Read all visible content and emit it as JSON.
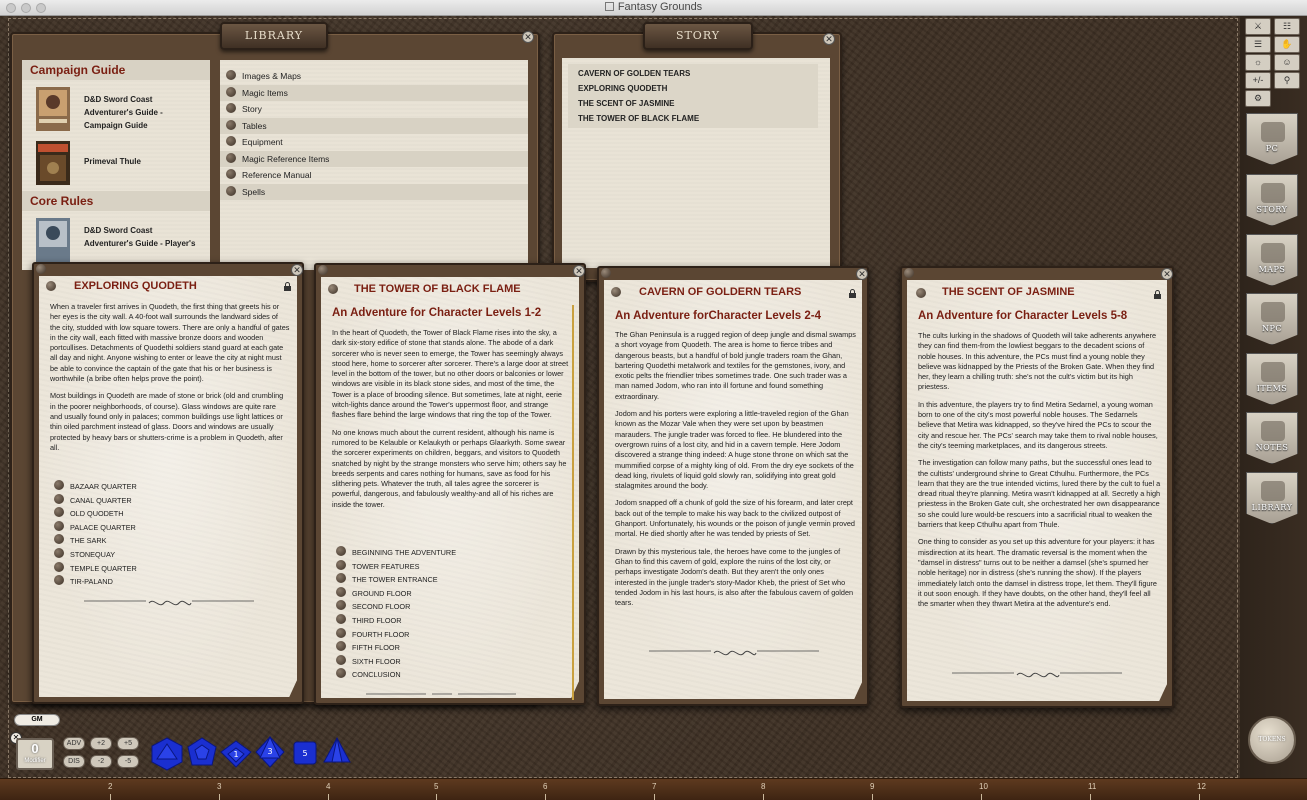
{
  "window": {
    "title": "Fantasy Grounds"
  },
  "library": {
    "tab": "LIBRARY",
    "categories": [
      {
        "heading": "Campaign Guide",
        "books": [
          "D&D Sword Coast Adventurer's Guide - Campaign Guide",
          "Primeval Thule"
        ]
      },
      {
        "heading": "Core Rules",
        "books": [
          "D&D Sword Coast Adventurer's Guide - Player's"
        ]
      }
    ],
    "items": [
      "Images & Maps",
      "Magic Items",
      "Story",
      "Tables",
      "Equipment",
      "Magic Reference Items",
      "Reference Manual",
      "Spells"
    ]
  },
  "story_list": {
    "tab": "STORY",
    "items": [
      "CAVERN OF GOLDEN TEARS",
      "EXPLORING QUODETH",
      "THE SCENT OF JASMINE",
      "THE TOWER OF BLACK FLAME"
    ]
  },
  "pages": [
    {
      "title": "EXPLORING QUODETH",
      "subtitle": "",
      "paragraphs": [
        "When a traveler first arrives in Quodeth, the first thing that greets his or her eyes is the city wall. A 40-foot wall surrounds the landward sides of the city, studded with low square towers. There are only a handful of gates in the city wall, each fitted with massive bronze doors and wooden portcullises. Detachments of Quodethi soldiers stand guard at each gate all day and night. Anyone wishing to enter or leave the city at night must be able to convince the captain of the gate that his or her business is worthwhile (a bribe often helps prove the point).",
        "Most buildings in Quodeth are made of stone or brick (old and crumbling in the poorer neighborhoods, of course). Glass windows are quite rare and usually found only in palaces; common buildings use light lattices or thin oiled parchment instead of glass. Doors and windows are usually protected by heavy bars or shutters-crime is a problem in Quodeth, after all."
      ],
      "links": [
        "BAZAAR QUARTER",
        "CANAL QUARTER",
        "OLD QUODETH",
        "PALACE QUARTER",
        "THE SARK",
        "STONEQUAY",
        "TEMPLE QUARTER",
        "TIR-PALAND"
      ]
    },
    {
      "title": "THE TOWER OF BLACK FLAME",
      "subtitle": "An Adventure for Character Levels 1-2",
      "paragraphs": [
        "In the heart of Quodeth, the Tower of Black Flame rises into the sky, a dark six-story edifice of stone that stands alone. The abode of a dark sorcerer who is never seen to emerge, the Tower has seemingly always stood here, home to sorcerer after sorcerer. There's a large door at street level in the bottom of the tower, but no other doors or balconies or lower windows are visible in its black stone sides, and most of the time, the Tower is a place of brooding silence. But sometimes, late at night, eerie witch-lights dance around the Tower's uppermost floor, and strange flashes flare behind the large windows that ring the top of the Tower.",
        "No one knows much about the current resident, although his name is rumored to be Kelauble or Kelaukyth or perhaps Glaarkyth. Some swear the sorcerer experiments on children, beggars, and visitors to Quodeth snatched by night by the strange monsters who serve him; others say he breeds serpents and cares nothing for humans, save as food for his slithering pets. Whatever the truth, all tales agree the sorcerer is powerful, dangerous, and fabulously wealthy-and all of his riches are inside the tower."
      ],
      "links": [
        "BEGINNING THE ADVENTURE",
        "TOWER FEATURES",
        "THE TOWER ENTRANCE",
        "GROUND FLOOR",
        "SECOND FLOOR",
        "THIRD FLOOR",
        "FOURTH FLOOR",
        "FIFTH FLOOR",
        "SIXTH FLOOR",
        "CONCLUSION"
      ]
    },
    {
      "title": "CAVERN OF GOLDERN TEARS",
      "subtitle": "An Adventure forCharacter Levels 2-4",
      "paragraphs": [
        "The Ghan Peninsula is a rugged region of deep jungle and dismal swamps a short voyage from Quodeth. The area is home to fierce tribes and dangerous beasts, but a handful of bold jungle traders roam the Ghan, bartering Quodethi metalwork and textiles for the gemstones, ivory, and exotic pelts the friendlier tribes sometimes trade. One such trader was a man named Jodom, who ran into ill fortune and found something extraordinary.",
        "Jodom and his porters were exploring a little-traveled region of the Ghan known as the Mozar Vale when they were set upon by beastmen marauders. The jungle trader was forced to flee. He blundered into the overgrown ruins of a lost city, and hid in a cavern temple. Here Jodom discovered a strange thing indeed: A huge stone throne on which sat the mummified corpse of a mighty king of old. From the dry eye sockets of the dead king, rivulets of liquid gold slowly ran, solidifying into great gold stalagmites around the body.",
        "Jodom snapped off a chunk of gold the size of his forearm, and later crept back out of the temple to make his way back to the civilized outpost of Ghanport. Unfortunately, his wounds or the poison of jungle vermin proved mortal. He died shortly after he was tended by priests of Set.",
        "Drawn by this mysterious tale, the heroes have come to the jungles of Ghan to find this cavern of gold, explore the ruins of the lost city, or perhaps investigate Jodom's death. But they aren't the only ones interested in the jungle trader's story-Mador Kheb, the priest of Set who tended Jodom in his last hours, is also after the fabulous cavern of golden tears."
      ],
      "links": []
    },
    {
      "title": "THE SCENT OF JASMINE",
      "subtitle": "An Adventure for Character Levels 5-8",
      "paragraphs": [
        "The cults lurking in the shadows of Quodeth will take adherents anywhere they can find them-from the lowliest beggars to the decadent scions of noble houses. In this adventure, the PCs must find a young noble they believe was kidnapped by the Priests of the Broken Gate. When they find her, they learn a chilling truth: she's not the cult's victim but its high priestess.",
        "In this adventure, the players try to find Metira Sedarnel, a young woman born to one of the city's most powerful noble houses. The Sedarnels believe that Metira was kidnapped, so they've hired the PCs to scour the city and rescue her. The PCs' search may take them to rival noble houses, the city's teeming marketplaces, and its dangerous streets.",
        "The investigation can follow many paths, but the successful ones lead to the cultists' underground shrine to Great Cthulhu. Furthermore, the PCs learn that they are the true intended victims, lured there by the cult to fuel a dread ritual they're planning. Metira wasn't kidnapped at all. Secretly a high priestess in the Broken Gate cult, she orchestrated her own disappearance so she could lure would-be rescuers into a sacrificial ritual to weaken the barriers that keep Cthulhu apart from Thule.",
        "One thing to consider as you set up this adventure for your players: it has misdirection at its heart. The dramatic reversal is the moment when the \"damsel in distress\" turns out to be neither a damsel (she's spurned her noble heritage) nor in distress (she's running the show). If the players immediately latch onto the damsel in distress trope, let them. They'll figure it out soon enough. If they have doubts, on the other hand, they'll feel all the smarter when they thwart Metira at the adventure's end."
      ],
      "links": []
    }
  ],
  "sidebar": {
    "buttons": [
      "PC",
      "STORY",
      "MAPS",
      "NPC",
      "ITEMS",
      "NOTES",
      "LIBRARY"
    ],
    "tools": [
      "+/-"
    ],
    "tokens": "TOKENS"
  },
  "bottom": {
    "gm_label": "GM",
    "modifier_value": "0",
    "modifier_label": "Modifier",
    "mod_buttons": [
      "ADV",
      "+2",
      "+5",
      "DIS",
      "-2",
      "-5"
    ],
    "dice": [
      "d20",
      "d12",
      "d10",
      "d8",
      "d6",
      "d4"
    ],
    "dice_labels": [
      "",
      "",
      "1",
      "3",
      "5",
      ""
    ],
    "ruler": [
      "2",
      "3",
      "4",
      "5",
      "6",
      "7",
      "8",
      "9",
      "10",
      "11",
      "12"
    ]
  },
  "colors": {
    "accent": "#7a1f12",
    "paper": "#ece6da",
    "leather": "#3e3024",
    "dice": "#1a2fd0"
  }
}
